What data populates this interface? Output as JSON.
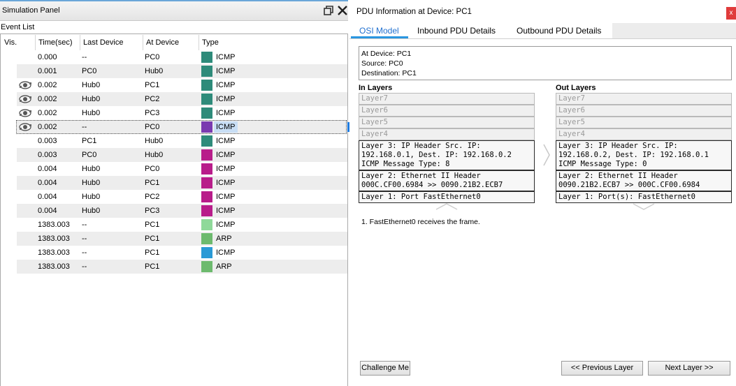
{
  "simulation_panel": {
    "title": "Simulation Panel",
    "event_list_label": "Event List",
    "columns": [
      "Vis.",
      "Time(sec)",
      "Last Device",
      "At Device",
      "Type"
    ],
    "rows": [
      {
        "vis": "",
        "time": "0.000",
        "last": "--",
        "at": "PC0",
        "type": "ICMP",
        "color": "#2e8b7a"
      },
      {
        "vis": "",
        "time": "0.001",
        "last": "PC0",
        "at": "Hub0",
        "type": "ICMP",
        "color": "#2e8b7a"
      },
      {
        "vis": "eye-icon",
        "time": "0.002",
        "last": "Hub0",
        "at": "PC1",
        "type": "ICMP",
        "color": "#2e8b7a"
      },
      {
        "vis": "eye-icon",
        "time": "0.002",
        "last": "Hub0",
        "at": "PC2",
        "type": "ICMP",
        "color": "#2e8b7a"
      },
      {
        "vis": "eye-icon",
        "time": "0.002",
        "last": "Hub0",
        "at": "PC3",
        "type": "ICMP",
        "color": "#2e8b7a"
      },
      {
        "vis": "eye-icon",
        "time": "0.002",
        "last": "--",
        "at": "PC0",
        "type": "ICMP",
        "color": "#7a3bb0",
        "selected": true
      },
      {
        "vis": "",
        "time": "0.003",
        "last": "PC1",
        "at": "Hub0",
        "type": "ICMP",
        "color": "#2e8b7a"
      },
      {
        "vis": "",
        "time": "0.003",
        "last": "PC0",
        "at": "Hub0",
        "type": "ICMP",
        "color": "#b81d8a"
      },
      {
        "vis": "",
        "time": "0.004",
        "last": "Hub0",
        "at": "PC0",
        "type": "ICMP",
        "color": "#b81d8a"
      },
      {
        "vis": "",
        "time": "0.004",
        "last": "Hub0",
        "at": "PC1",
        "type": "ICMP",
        "color": "#b81d8a"
      },
      {
        "vis": "",
        "time": "0.004",
        "last": "Hub0",
        "at": "PC2",
        "type": "ICMP",
        "color": "#b81d8a"
      },
      {
        "vis": "",
        "time": "0.004",
        "last": "Hub0",
        "at": "PC3",
        "type": "ICMP",
        "color": "#b81d8a"
      },
      {
        "vis": "",
        "time": "1383.003",
        "last": "--",
        "at": "PC1",
        "type": "ICMP",
        "color": "#8fd99a"
      },
      {
        "vis": "",
        "time": "1383.003",
        "last": "--",
        "at": "PC1",
        "type": "ARP",
        "color": "#6dba6e"
      },
      {
        "vis": "",
        "time": "1383.003",
        "last": "--",
        "at": "PC1",
        "type": "ICMP",
        "color": "#2a9ad6"
      },
      {
        "vis": "",
        "time": "1383.003",
        "last": "--",
        "at": "PC1",
        "type": "ARP",
        "color": "#6dba6e"
      }
    ]
  },
  "pdu": {
    "title": "PDU Information at Device: PC1",
    "close_label": "x",
    "tabs": [
      "OSI Model",
      "Inbound PDU Details",
      "Outbound PDU Details"
    ],
    "info": {
      "at_device": "At Device: PC1",
      "source": "Source: PC0",
      "destination": "Destination: PC1"
    },
    "in_layers_title": "In Layers",
    "out_layers_title": "Out Layers",
    "in_layers": [
      "Layer7",
      "Layer6",
      "Layer5",
      "Layer4",
      "Layer 3: IP Header Src. IP: 192.168.0.1, Dest. IP: 192.168.0.2 ICMP Message Type: 8",
      "Layer 2: Ethernet II Header 000C.CF00.6984 >> 0090.21B2.ECB7",
      "Layer 1: Port FastEthernet0"
    ],
    "out_layers": [
      "Layer7",
      "Layer6",
      "Layer5",
      "Layer4",
      "Layer 3: IP Header Src. IP: 192.168.0.2, Dest. IP: 192.168.0.1 ICMP Message Type: 0",
      "Layer 2: Ethernet II Header 0090.21B2.ECB7 >> 000C.CF00.6984",
      "Layer 1: Port(s): FastEthernet0"
    ],
    "explanation": "1. FastEthernet0 receives the frame.",
    "buttons": {
      "challenge": "Challenge Me",
      "previous": "<< Previous Layer",
      "next": "Next Layer >>"
    }
  }
}
